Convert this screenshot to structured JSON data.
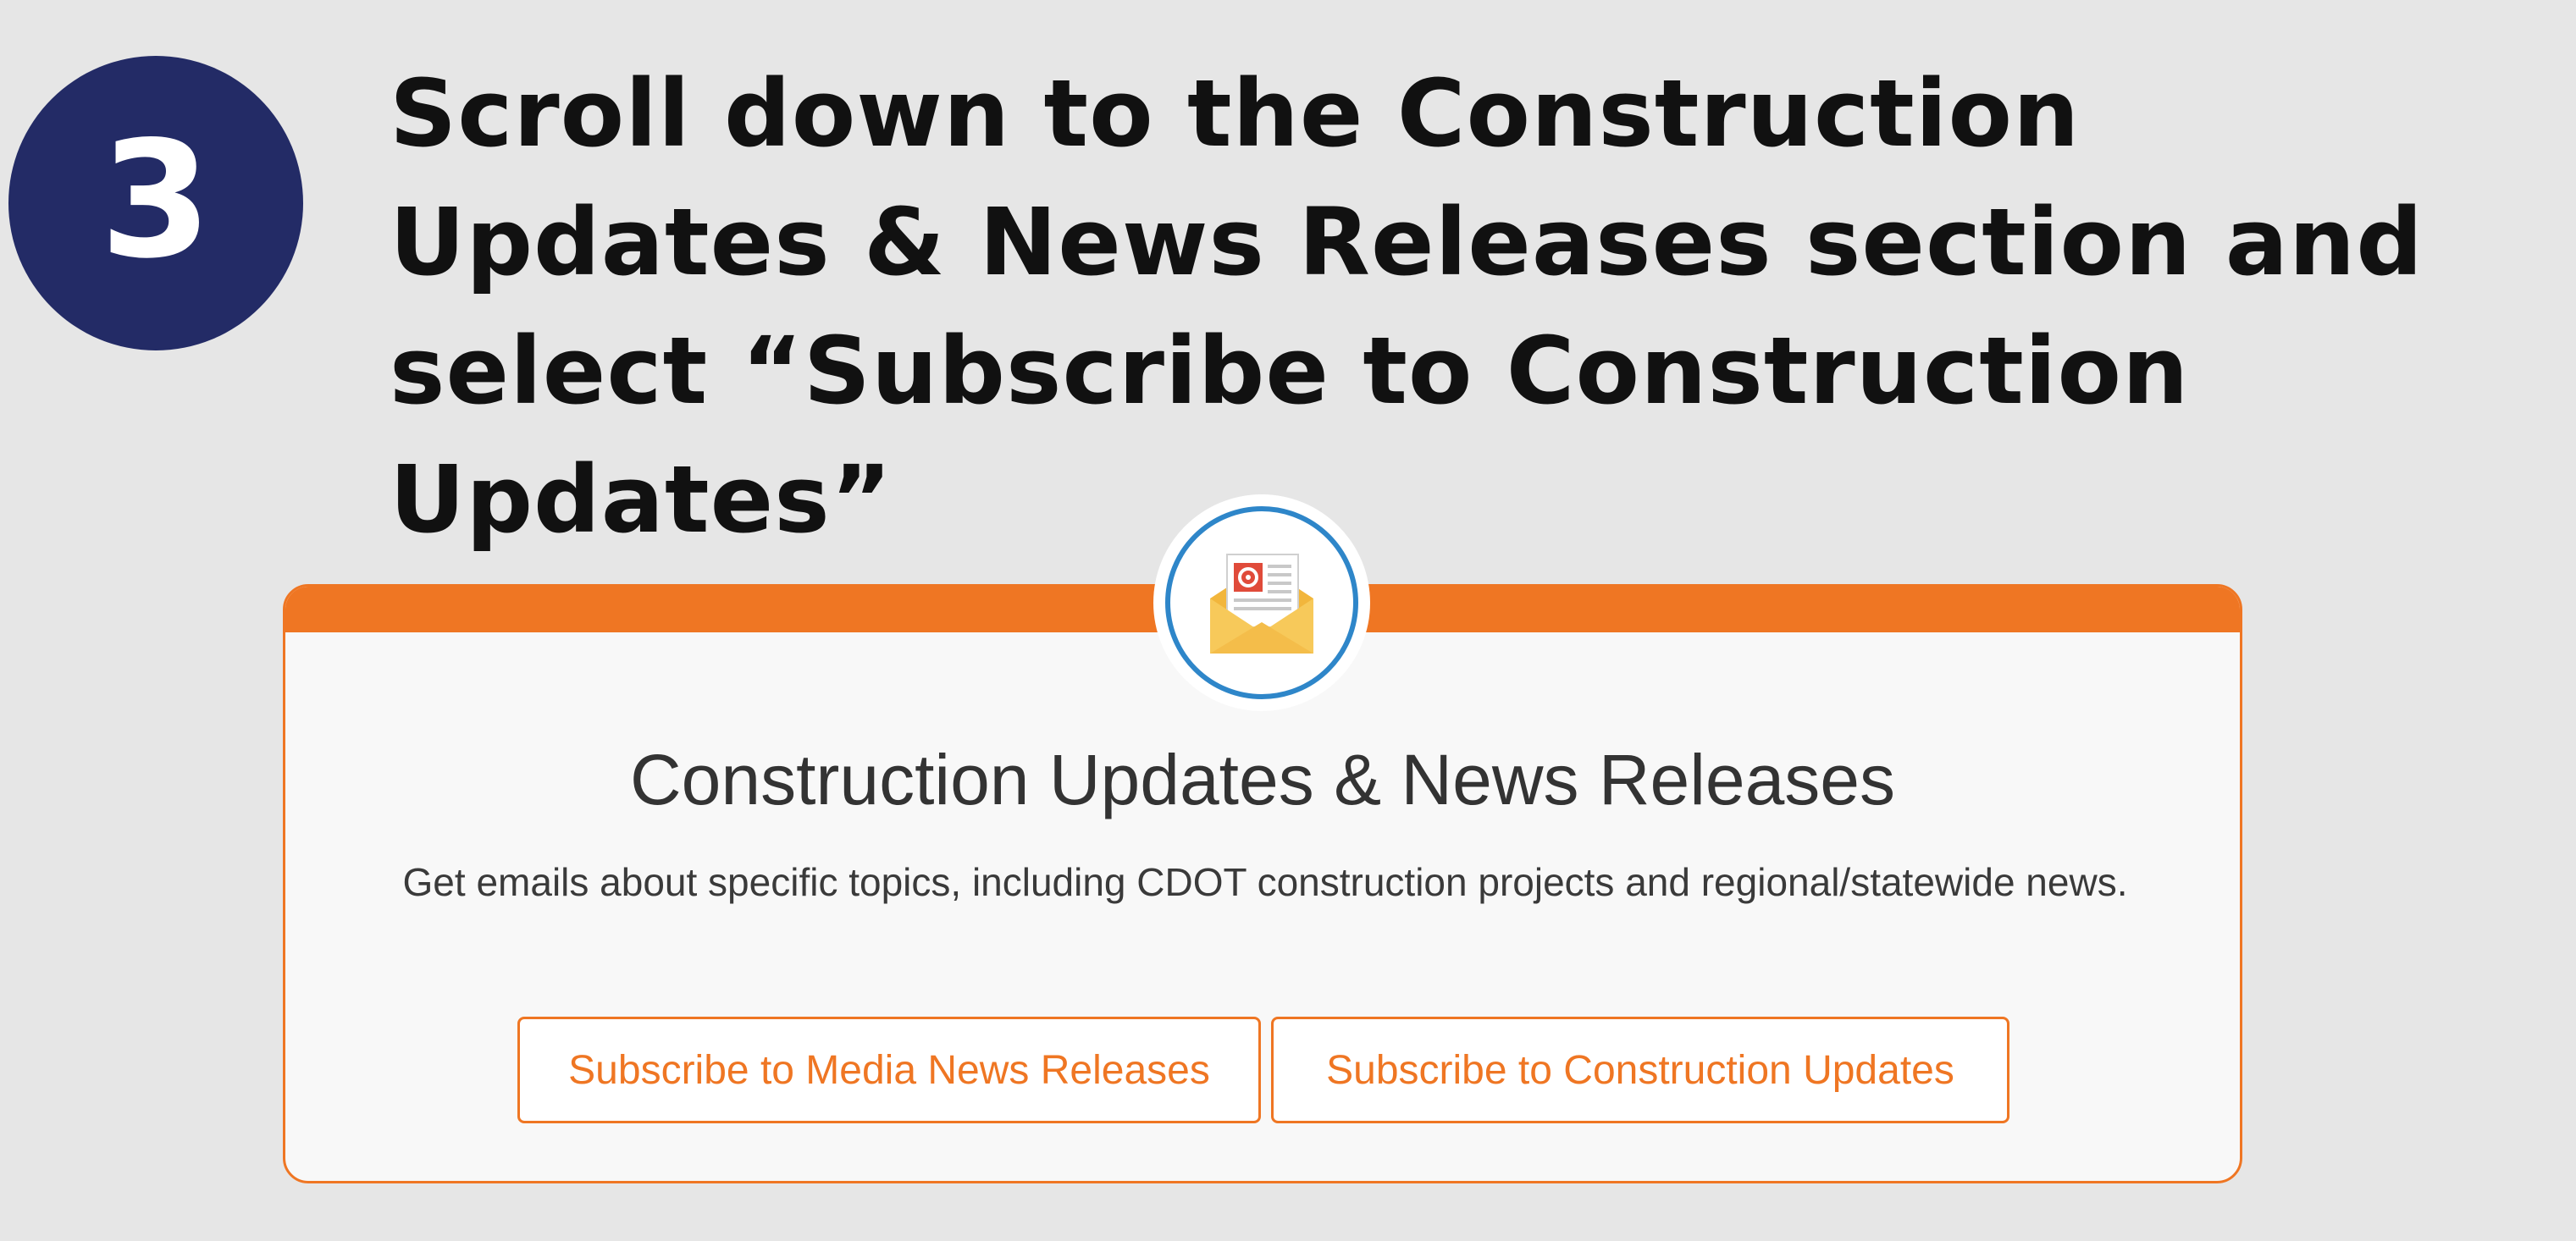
{
  "step": {
    "number": "3"
  },
  "instruction": {
    "text": "Scroll down to the Construction Updates & News Releases section and select “Subscribe to Construction Updates”"
  },
  "card": {
    "icon": "email-newsletter-icon",
    "title": "Construction Updates & News Releases",
    "description": "Get emails about specific topics, including CDOT construction projects and regional/statewide news.",
    "buttons": {
      "media_label": "Subscribe to Media News Releases",
      "construction_label": "Subscribe to Construction Updates"
    }
  },
  "colors": {
    "accent": "#ef7623",
    "step_circle": "#232b66",
    "icon_ring": "#2e86c9",
    "background": "#e6e6e6"
  }
}
